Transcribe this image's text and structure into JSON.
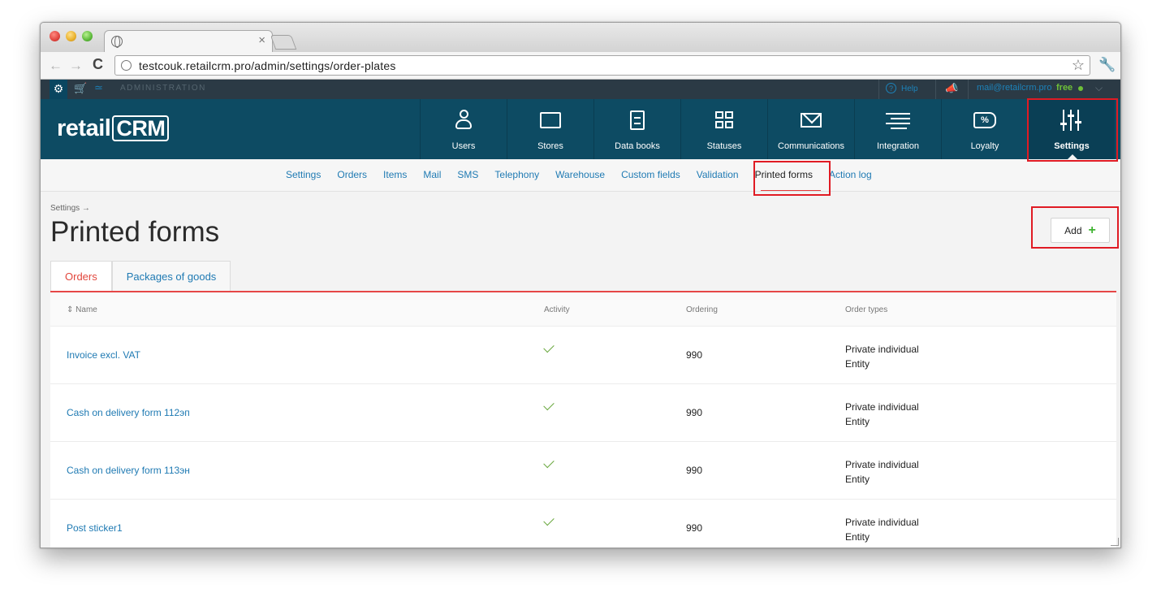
{
  "browser": {
    "tab_close": "×",
    "url": "testcouk.retailcrm.pro/admin/settings/order-plates",
    "back": "←",
    "forward": "→",
    "reload": "C",
    "star": "☆",
    "menu_icon": "wrench-icon"
  },
  "topbar": {
    "admin_label": "ADMINISTRATION",
    "help_label": "Help",
    "email": "mail@retailcrm.pro",
    "plan": "free",
    "chevron": "⌵"
  },
  "logo": {
    "prefix": "retail",
    "crm": "CRM"
  },
  "main_menu": [
    {
      "label": "Users",
      "icon": "user-icon"
    },
    {
      "label": "Stores",
      "icon": "store-icon"
    },
    {
      "label": "Data books",
      "icon": "databook-icon"
    },
    {
      "label": "Statuses",
      "icon": "statuses-icon"
    },
    {
      "label": "Communications",
      "icon": "communications-icon"
    },
    {
      "label": "Integration",
      "icon": "integration-icon"
    },
    {
      "label": "Loyalty",
      "icon": "loyalty-icon",
      "badge": "%"
    },
    {
      "label": "Settings",
      "icon": "settings-icon",
      "active": true
    }
  ],
  "sub_nav": [
    "Settings",
    "Orders",
    "Items",
    "Mail",
    "SMS",
    "Telephony",
    "Warehouse",
    "Custom fields",
    "Validation",
    "Printed forms",
    "Action log"
  ],
  "sub_nav_active": "Printed forms",
  "page": {
    "breadcrumb": "Settings →",
    "title": "Printed forms",
    "add_label": "Add",
    "add_plus": "+"
  },
  "tabs": [
    {
      "label": "Orders",
      "active": true
    },
    {
      "label": "Packages of goods",
      "active": false
    }
  ],
  "table": {
    "sort_icon": "⇕",
    "columns": [
      "Name",
      "Activity",
      "Ordering",
      "Order types"
    ],
    "rows": [
      {
        "name": "Invoice excl. VAT",
        "active": true,
        "ordering": "990",
        "type1": "Private individual",
        "type2": "Entity"
      },
      {
        "name": "Cash on delivery form 112эп",
        "active": true,
        "ordering": "990",
        "type1": "Private individual",
        "type2": "Entity"
      },
      {
        "name": "Cash on delivery form 113эн",
        "active": true,
        "ordering": "990",
        "type1": "Private individual",
        "type2": "Entity"
      },
      {
        "name": "Post sticker1",
        "active": true,
        "ordering": "990",
        "type1": "Private individual",
        "type2": "Entity"
      }
    ]
  },
  "colors": {
    "header_bg": "#0d4b63",
    "link": "#1f7ab3",
    "highlight": "#e01b24",
    "active_tab": "#e2473d",
    "plan_green": "#6ec038"
  }
}
